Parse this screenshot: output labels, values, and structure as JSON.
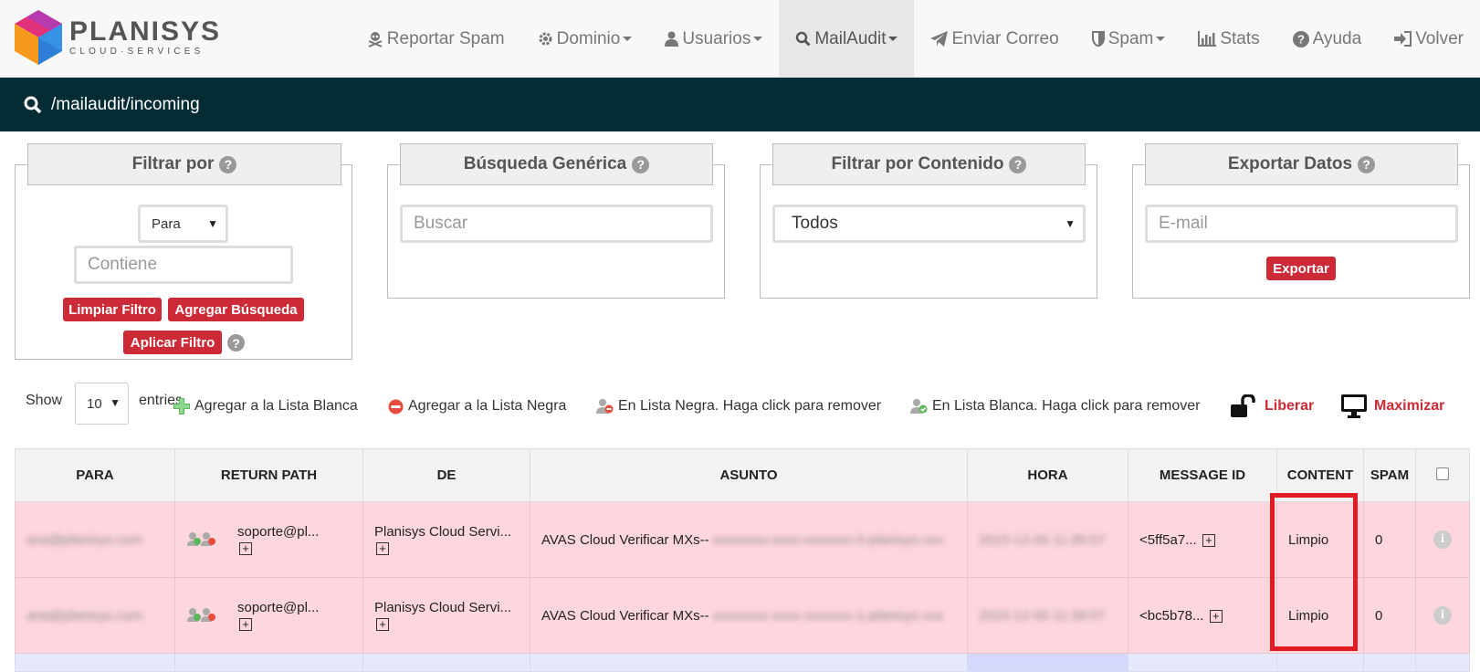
{
  "brand": {
    "name": "PLANISYS",
    "tagline": "CLOUD·SERVICES"
  },
  "nav": {
    "report_spam": "Reportar Spam",
    "dominio": "Dominio",
    "usuarios": "Usuarios",
    "mailaudit": "MailAudit",
    "enviar_correo": "Enviar Correo",
    "spam": "Spam",
    "stats": "Stats",
    "ayuda": "Ayuda",
    "volver": "Volver"
  },
  "path": "/mailaudit/incoming",
  "filters": {
    "filtrar_por": {
      "title": "Filtrar por",
      "field_value": "Para",
      "contains_placeholder": "Contiene",
      "clear_label": "Limpiar Filtro",
      "add_label": "Agregar Búsqueda",
      "apply_label": "Aplicar Filtro"
    },
    "busqueda": {
      "title": "Búsqueda Genérica",
      "placeholder": "Buscar"
    },
    "contenido": {
      "title": "Filtrar por Contenido",
      "value": "Todos"
    },
    "exportar": {
      "title": "Exportar Datos",
      "placeholder": "E-mail",
      "button": "Exportar"
    }
  },
  "toolbar": {
    "show_label": "Show",
    "page_size": "10",
    "entries_label": "entries",
    "add_whitelist": "Agregar a la Lista Blanca",
    "add_blacklist": "Agregar a la Lista Negra",
    "in_blacklist": "En Lista Negra. Haga click para remover",
    "in_whitelist": "En Lista Blanca. Haga click para remover",
    "liberar": "Liberar",
    "maximizar": "Maximizar"
  },
  "table": {
    "headers": [
      "PARA",
      "RETURN PATH",
      "DE",
      "ASUNTO",
      "HORA",
      "MESSAGE ID",
      "CONTENT",
      "SPAM"
    ],
    "rows": [
      {
        "para": "ana@planisys.com",
        "return_path": "soporte@pl...",
        "de": "Planisys Cloud Servi...",
        "asunto": "AVAS Cloud Verificar MXs--",
        "asunto_hidden": "xxxxxxxx-xxxx-xxxxxxx-0-planisys-xxx",
        "hora": "2015-12-00 11:39:57",
        "message_id": "<5ff5a7...",
        "content": "Limpio",
        "spam": "0"
      },
      {
        "para": "ana@planisys.com",
        "return_path": "soporte@pl...",
        "de": "Planisys Cloud Servi...",
        "asunto": "AVAS Cloud Verificar MXs--",
        "asunto_hidden": "xxxxxxxx-xxxx-xxxxxxx-1-planisys-xxx",
        "hora": "2015-12-00 11:39:57",
        "message_id": "<bc5b78...",
        "content": "Limpio",
        "spam": "0"
      }
    ]
  },
  "colors": {
    "accent": "#cc2a36",
    "pathbar": "#032c35",
    "row_bg": "#fed6de",
    "highlight": "#e01b24"
  }
}
